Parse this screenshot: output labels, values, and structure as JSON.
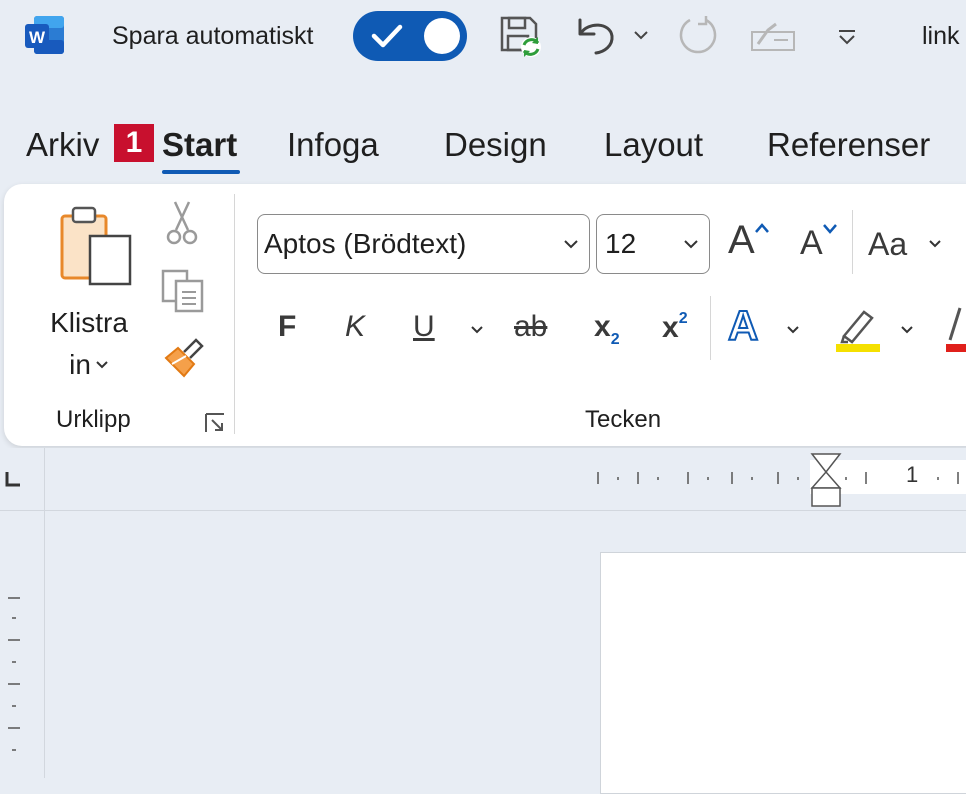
{
  "titlebar": {
    "app_icon": "word-icon",
    "autosave_label": "Spara automatiskt",
    "autosave_on": true,
    "doc_title": "link",
    "icons": [
      "save-sync-icon",
      "undo-icon",
      "redo-icon",
      "format-painter-disabled-icon",
      "customize-qat-icon"
    ]
  },
  "tabs": [
    {
      "label": "Arkiv",
      "active": false
    },
    {
      "label": "Start",
      "active": true
    },
    {
      "label": "Infoga",
      "active": false
    },
    {
      "label": "Design",
      "active": false
    },
    {
      "label": "Layout",
      "active": false
    },
    {
      "label": "Referenser",
      "active": false
    }
  ],
  "keytip": "1",
  "ribbon": {
    "clipboard": {
      "paste_line1": "Klistra",
      "paste_line2": "in",
      "group_label": "Urklipp"
    },
    "font": {
      "font_name": "Aptos (Brödtext)",
      "font_size": "12",
      "case_label": "Aa",
      "bold": "F",
      "italic": "K",
      "underline": "U",
      "strike": "ab",
      "subscript": "x",
      "subscript_mark": "2",
      "superscript": "x",
      "superscript_mark": "2",
      "grow": "A",
      "shrink": "A",
      "text_effects": "A",
      "group_label": "Tecken",
      "highlight_color": "#f5e000",
      "font_color": "#e0201b"
    }
  },
  "ruler": {
    "number": "1"
  },
  "colors": {
    "accent": "#0f5ab4",
    "background": "#e8edf4",
    "keytip": "#c8102e"
  }
}
